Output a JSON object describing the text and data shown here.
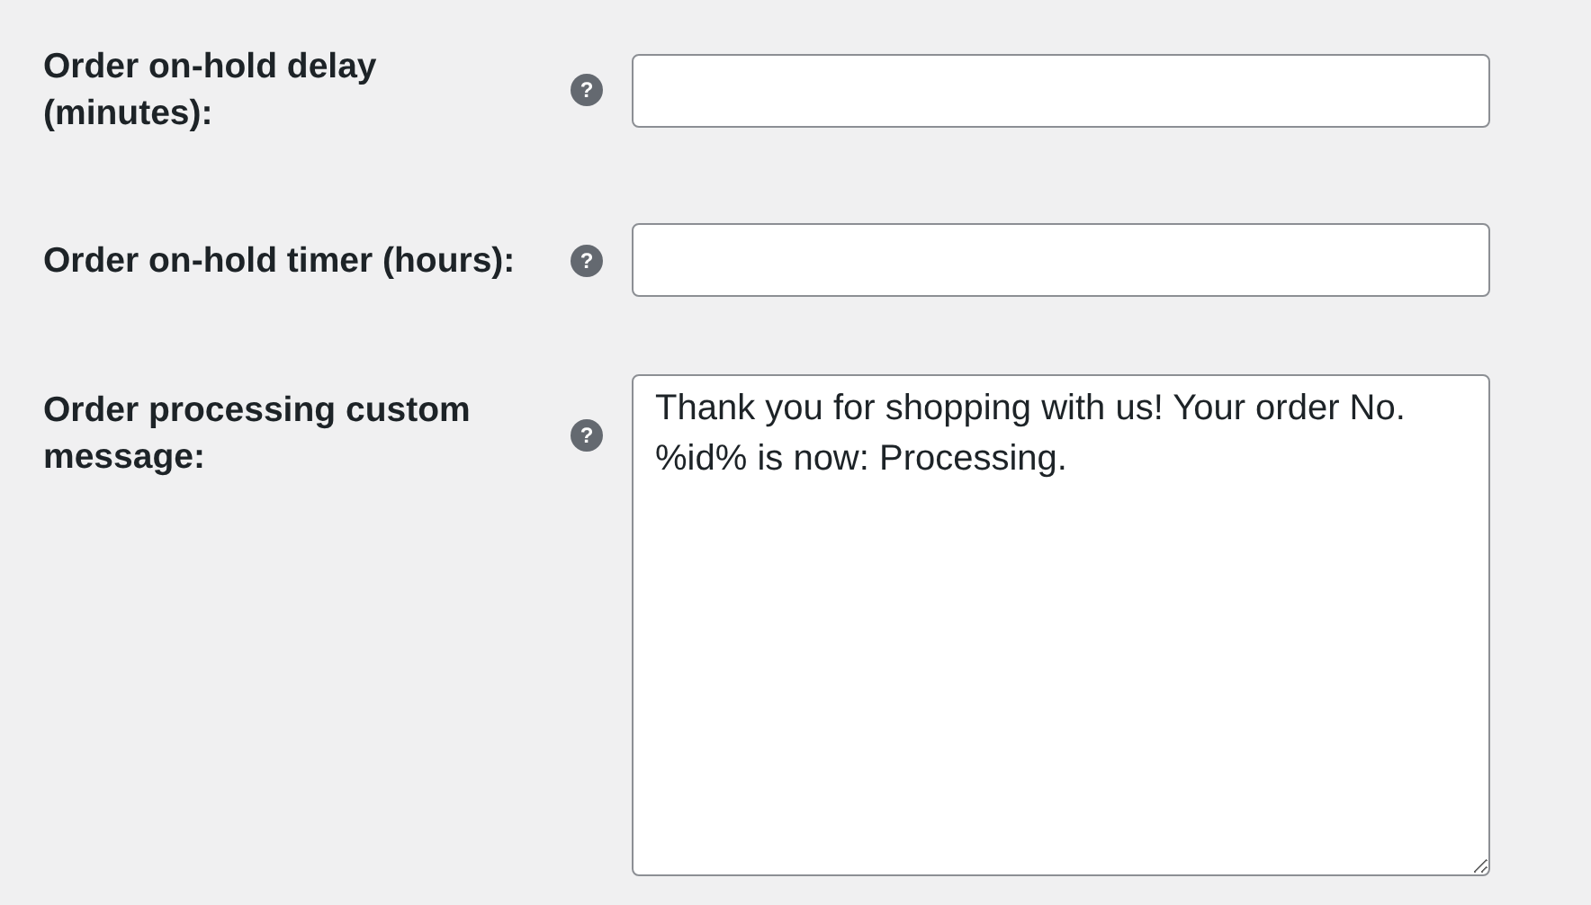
{
  "settings": [
    {
      "label": "Order on-hold delay (minutes):",
      "help": "?",
      "kind": "text"
    },
    {
      "label": "Order on-hold timer (hours):",
      "help": "?",
      "kind": "text"
    },
    {
      "label": "Order processing custom message:",
      "help": "?",
      "kind": "textarea",
      "value": "Thank you for shopping with us! Your order No. %id% is now: Processing."
    }
  ]
}
